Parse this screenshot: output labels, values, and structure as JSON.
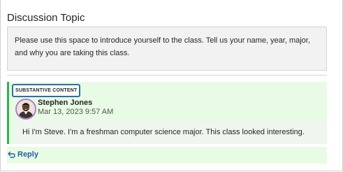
{
  "discussion": {
    "title": "Discussion Topic",
    "prompt": "Please use this space to introduce yourself to the class. Tell us your name, year, major, and why you are taking this class."
  },
  "post": {
    "badge": "SUBSTANTIVE CONTENT",
    "author": "Stephen Jones",
    "date": "Mar 13, 2023 9:57 AM",
    "body": "Hi I'm Steve. I'm a freshman computer science major. This class looked interesting.",
    "avatar_icon": "user-avatar-icon",
    "accent_color": "#2fb24a",
    "badge_border_color": "#2b6ea8"
  },
  "actions": {
    "reply_label": "Reply",
    "reply_icon": "reply-arrow-icon",
    "link_color": "#2660a4"
  }
}
